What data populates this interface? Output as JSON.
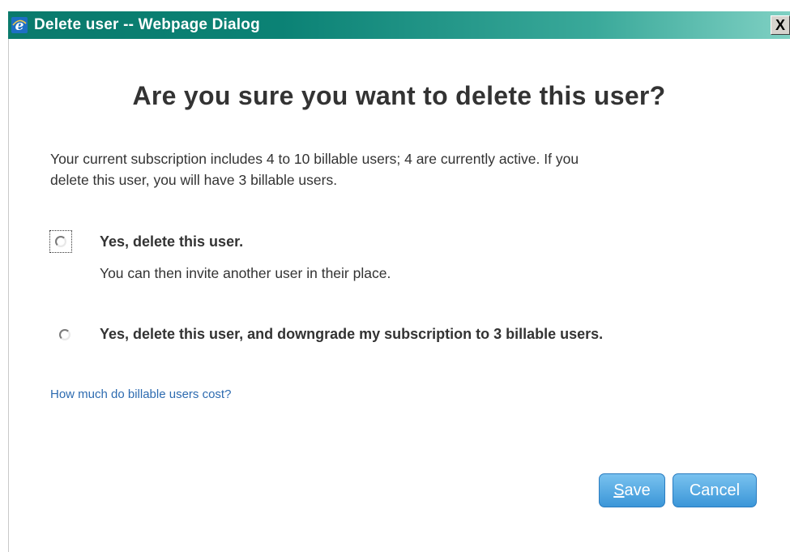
{
  "window": {
    "title": "Delete user -- Webpage Dialog",
    "close_glyph": "X"
  },
  "dialog": {
    "heading": "Are you sure you want to delete this user?",
    "info_line1": "Your current subscription includes 4 to 10 billable users; 4 are currently active. If you",
    "info_line2": "delete this user, you will have 3 billable users.",
    "options": [
      {
        "label": "Yes, delete this user.",
        "sublabel": "You can then invite another user in their place.",
        "selected": false,
        "focused": true
      },
      {
        "label": "Yes, delete this user, and downgrade my subscription to 3 billable users.",
        "selected": false,
        "focused": false
      }
    ],
    "help_link": "How much do billable users cost?",
    "buttons": {
      "save_first": "S",
      "save_rest": "ave",
      "cancel": "Cancel"
    }
  },
  "colors": {
    "titlebar": "#0b8275",
    "link": "#2d6bb0",
    "button": "#4aa3e0",
    "text": "#333333"
  }
}
